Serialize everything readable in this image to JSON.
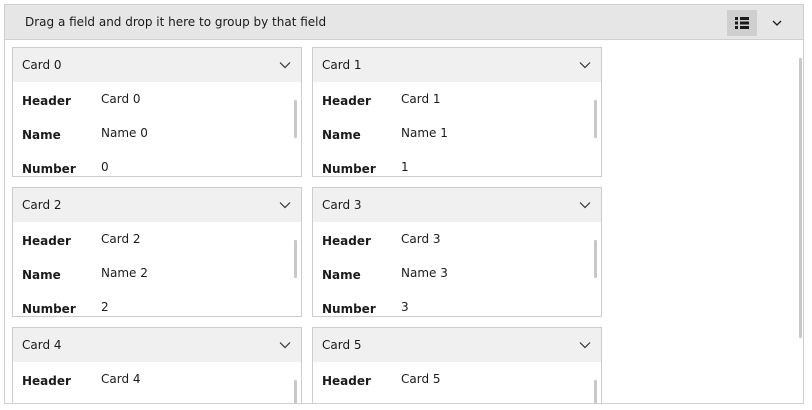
{
  "group_panel": {
    "text": "Drag a field and drop it here to group by that field",
    "view_icon": "list-view-icon",
    "dropdown_icon": "chevron-down-icon"
  },
  "fields": {
    "header_label": "Header",
    "name_label": "Name",
    "number_label": "Number"
  },
  "cards": [
    {
      "title": "Card 0",
      "header": "Card 0",
      "name": "Name 0",
      "number": "0"
    },
    {
      "title": "Card 1",
      "header": "Card 1",
      "name": "Name 1",
      "number": "1"
    },
    {
      "title": "Card 2",
      "header": "Card 2",
      "name": "Name 2",
      "number": "2"
    },
    {
      "title": "Card 3",
      "header": "Card 3",
      "name": "Name 3",
      "number": "3"
    },
    {
      "title": "Card 4",
      "header": "Card 4"
    },
    {
      "title": "Card 5",
      "header": "Card 5"
    }
  ],
  "colors": {
    "panel_bg": "#e6e6e6",
    "card_header_bg": "#f0f0f0",
    "border": "#cccccc"
  }
}
